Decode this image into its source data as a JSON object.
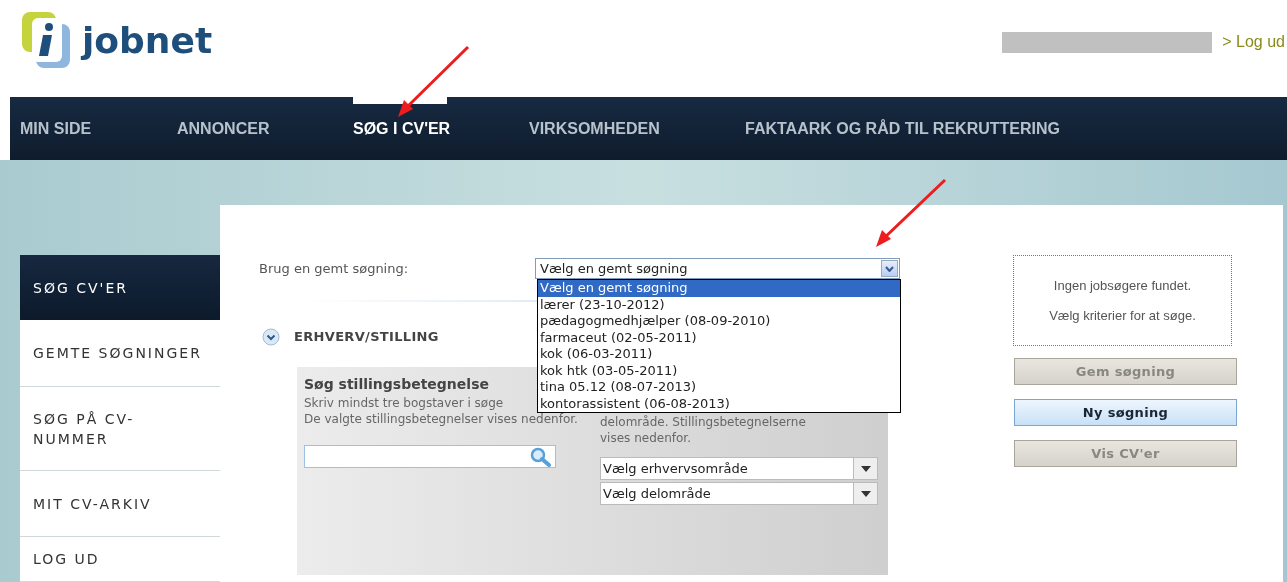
{
  "header": {
    "logo": "jobnet",
    "user_link": "> Log ud"
  },
  "nav": [
    {
      "label": "MIN SIDE",
      "selected": false
    },
    {
      "label": "ANNONCER",
      "selected": false
    },
    {
      "label": "SØG I CV'ER",
      "selected": true
    },
    {
      "label": "VIRKSOMHEDEN",
      "selected": false
    },
    {
      "label": "FAKTAARK OG RÅD TIL REKRUTTERING",
      "selected": false
    }
  ],
  "sidebar": [
    {
      "label": "SØG CV'ER",
      "selected": true
    },
    {
      "label": "GEMTE SØGNINGER",
      "selected": false
    },
    {
      "label": "SØG PÅ CV-NUMMER",
      "selected": false
    },
    {
      "label": "MIT CV-ARKIV",
      "selected": false
    },
    {
      "label": "LOG UD",
      "selected": false
    }
  ],
  "saved_search": {
    "label": "Brug en gemt søgning:",
    "value": "Vælg en gemt søgning",
    "expanded": true,
    "options": [
      {
        "label": "Vælg en gemt søgning",
        "selected": true
      },
      {
        "label": "lærer (23-10-2012)",
        "selected": false
      },
      {
        "label": "pædagogmedhjælper (08-09-2010)",
        "selected": false
      },
      {
        "label": "farmaceut (02-05-2011)",
        "selected": false
      },
      {
        "label": "kok (06-03-2011)",
        "selected": false
      },
      {
        "label": "kok htk (03-05-2011)",
        "selected": false
      },
      {
        "label": "tina 05.12 (08-07-2013)",
        "selected": false
      },
      {
        "label": "kontorassistent (06-08-2013)",
        "selected": false
      }
    ]
  },
  "section": {
    "title": "ERHVERV/STILLING",
    "expanded": true
  },
  "job_title_search": {
    "title": "Søg stillingsbetegnelse",
    "help_lines": [
      "Skriv mindst tre bogstaver i søge",
      "De valgte stillingsbetegnelser vises nedenfor."
    ]
  },
  "category_select": {
    "help": "delområde. Stillingsbetegnelserne vises nedenfor.",
    "selects": [
      "Vælg erhvervsområde",
      "Vælg delområde"
    ]
  },
  "results": {
    "lines": [
      "Ingen jobsøgere fundet.",
      "Vælg kriterier for at søge."
    ]
  },
  "buttons": [
    {
      "label": "Gem søgning",
      "kind": "secondary",
      "disabled": true
    },
    {
      "label": "Ny søgning",
      "kind": "primary",
      "disabled": false
    },
    {
      "label": "Vis CV'er",
      "kind": "secondary",
      "disabled": true
    }
  ]
}
